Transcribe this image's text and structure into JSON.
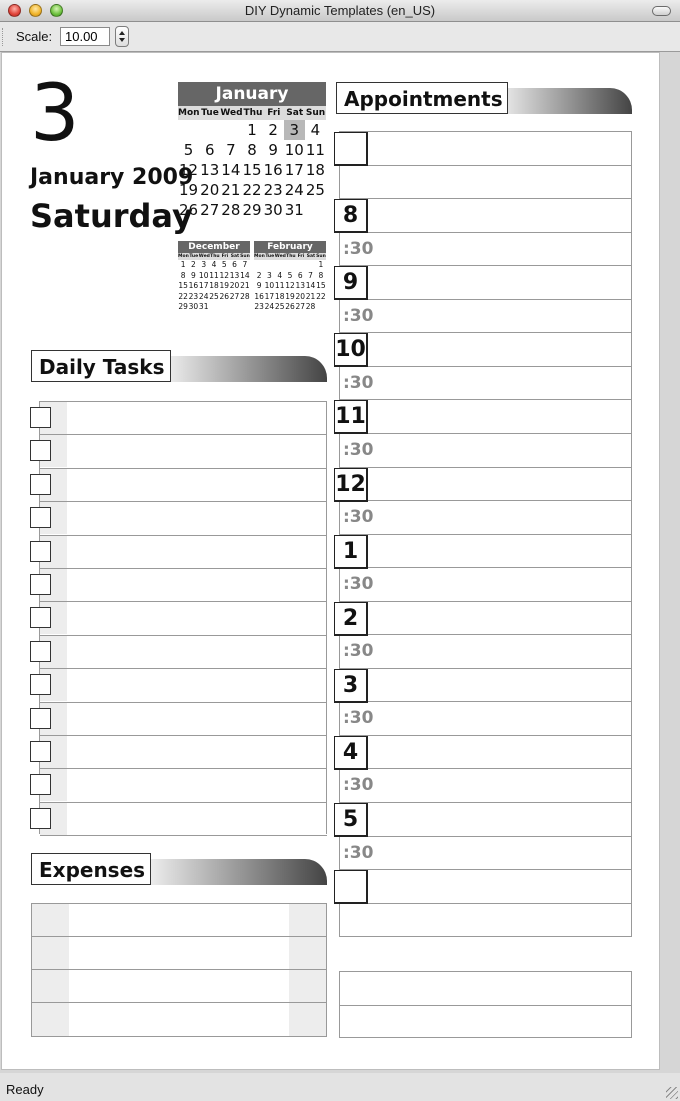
{
  "window": {
    "title": "DIY Dynamic Templates (en_US)"
  },
  "toolbar": {
    "scale_label": "Scale:",
    "scale_value": "10.00"
  },
  "status": {
    "text": "Ready"
  },
  "date": {
    "day": "3",
    "month_year": "January 2009",
    "weekday": "Saturday"
  },
  "minical_main": {
    "title": "January",
    "dows": [
      "Mon",
      "Tue",
      "Wed",
      "Thu",
      "Fri",
      "Sat",
      "Sun"
    ],
    "days": [
      "",
      "",
      "",
      "1",
      "2",
      "3",
      "4",
      "5",
      "6",
      "7",
      "8",
      "9",
      "10",
      "11",
      "12",
      "13",
      "14",
      "15",
      "16",
      "17",
      "18",
      "19",
      "20",
      "21",
      "22",
      "23",
      "24",
      "25",
      "26",
      "27",
      "28",
      "29",
      "30",
      "31"
    ],
    "selected": "3"
  },
  "minical_prev": {
    "title": "December",
    "dows": [
      "Mon",
      "Tue",
      "Wed",
      "Thu",
      "Fri",
      "Sat",
      "Sun"
    ],
    "days": [
      "1",
      "2",
      "3",
      "4",
      "5",
      "6",
      "7",
      "8",
      "9",
      "10",
      "11",
      "12",
      "13",
      "14",
      "15",
      "16",
      "17",
      "18",
      "19",
      "20",
      "21",
      "22",
      "23",
      "24",
      "25",
      "26",
      "27",
      "28",
      "29",
      "30",
      "31"
    ]
  },
  "minical_next": {
    "title": "February",
    "dows": [
      "Mon",
      "Tue",
      "Wed",
      "Thu",
      "Fri",
      "Sat",
      "Sun"
    ],
    "days": [
      "",
      "",
      "",
      "",
      "",
      "",
      "1",
      "2",
      "3",
      "4",
      "5",
      "6",
      "7",
      "8",
      "9",
      "10",
      "11",
      "12",
      "13",
      "14",
      "15",
      "16",
      "17",
      "18",
      "19",
      "20",
      "21",
      "22",
      "23",
      "24",
      "25",
      "26",
      "27",
      "28"
    ]
  },
  "sections": {
    "tasks": "Daily Tasks",
    "expenses": "Expenses",
    "appointments": "Appointments"
  },
  "appointments": {
    "hours": [
      "8",
      "9",
      "10",
      "11",
      "12",
      "1",
      "2",
      "3",
      "4",
      "5"
    ],
    "half_label": ":30"
  }
}
